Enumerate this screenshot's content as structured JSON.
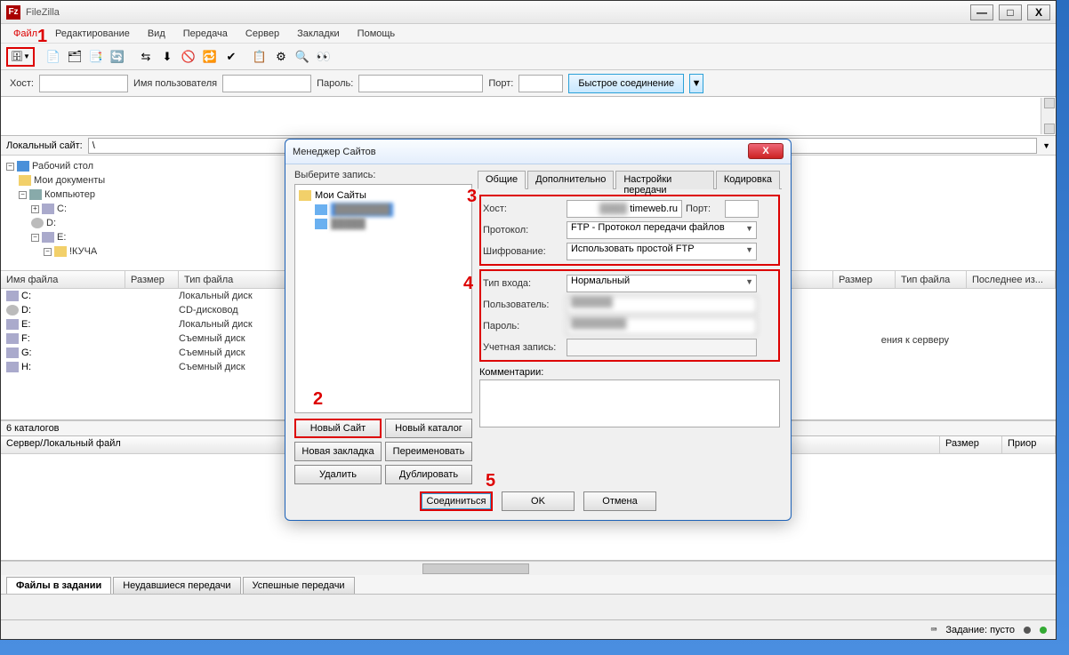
{
  "app": {
    "title": "FileZilla"
  },
  "window_controls": {
    "min": "—",
    "max": "□",
    "close": "X"
  },
  "menu": [
    "Файл",
    "Редактирование",
    "Вид",
    "Передача",
    "Сервер",
    "Закладки",
    "Помощь"
  ],
  "quickbar": {
    "host_label": "Хост:",
    "user_label": "Имя пользователя",
    "pass_label": "Пароль:",
    "port_label": "Порт:",
    "connect_btn": "Быстрое соединение"
  },
  "local": {
    "site_label": "Локальный сайт:",
    "site_value": "\\",
    "tree": {
      "root": "Рабочий стол",
      "docs": "Мои документы",
      "computer": "Компьютер",
      "c": "C:",
      "d": "D:",
      "e": "E:",
      "kucha": "!КУЧА"
    },
    "cols": {
      "name": "Имя файла",
      "size": "Размер",
      "type": "Тип файла"
    },
    "rows": [
      {
        "name": "C:",
        "type": "Локальный диск"
      },
      {
        "name": "D:",
        "type": "CD-дисковод"
      },
      {
        "name": "E:",
        "type": "Локальный диск"
      },
      {
        "name": "F:",
        "type": "Съемный диск"
      },
      {
        "name": "G:",
        "type": "Съемный диск"
      },
      {
        "name": "H:",
        "type": "Съемный диск"
      }
    ],
    "count": "6 каталогов"
  },
  "remote": {
    "cols": {
      "size": "Размер",
      "type": "Тип файла",
      "last": "Последнее из..."
    },
    "msg": "ения к серверу"
  },
  "queue": {
    "header": "Сервер/Локальный файл",
    "size": "Размер",
    "prio": "Приор",
    "tabs": [
      "Файлы в задании",
      "Неудавшиеся передачи",
      "Успешные передачи"
    ]
  },
  "status": {
    "task": "Задание: пусто"
  },
  "dialog": {
    "title": "Менеджер Сайтов",
    "select_label": "Выберите запись:",
    "tree_root": "Мои Сайты",
    "buttons": {
      "new_site": "Новый Сайт",
      "new_folder": "Новый каталог",
      "new_bookmark": "Новая закладка",
      "rename": "Переименовать",
      "delete": "Удалить",
      "duplicate": "Дублировать"
    },
    "tabs": [
      "Общие",
      "Дополнительно",
      "Настройки передачи",
      "Кодировка"
    ],
    "fields": {
      "host_label": "Хост:",
      "host_value": "timeweb.ru",
      "port_label": "Порт:",
      "protocol_label": "Протокол:",
      "protocol_value": "FTP - Протокол передачи файлов",
      "crypto_label": "Шифрование:",
      "crypto_value": "Использовать простой FTP",
      "logon_label": "Тип входа:",
      "logon_value": "Нормальный",
      "user_label": "Пользователь:",
      "pass_label": "Пароль:",
      "account_label": "Учетная запись:",
      "comment_label": "Комментарии:"
    },
    "bottom": {
      "connect": "Соединиться",
      "ok": "OK",
      "cancel": "Отмена"
    }
  },
  "annotations": {
    "a1": "1",
    "a2": "2",
    "a3": "3",
    "a4": "4",
    "a5": "5"
  }
}
